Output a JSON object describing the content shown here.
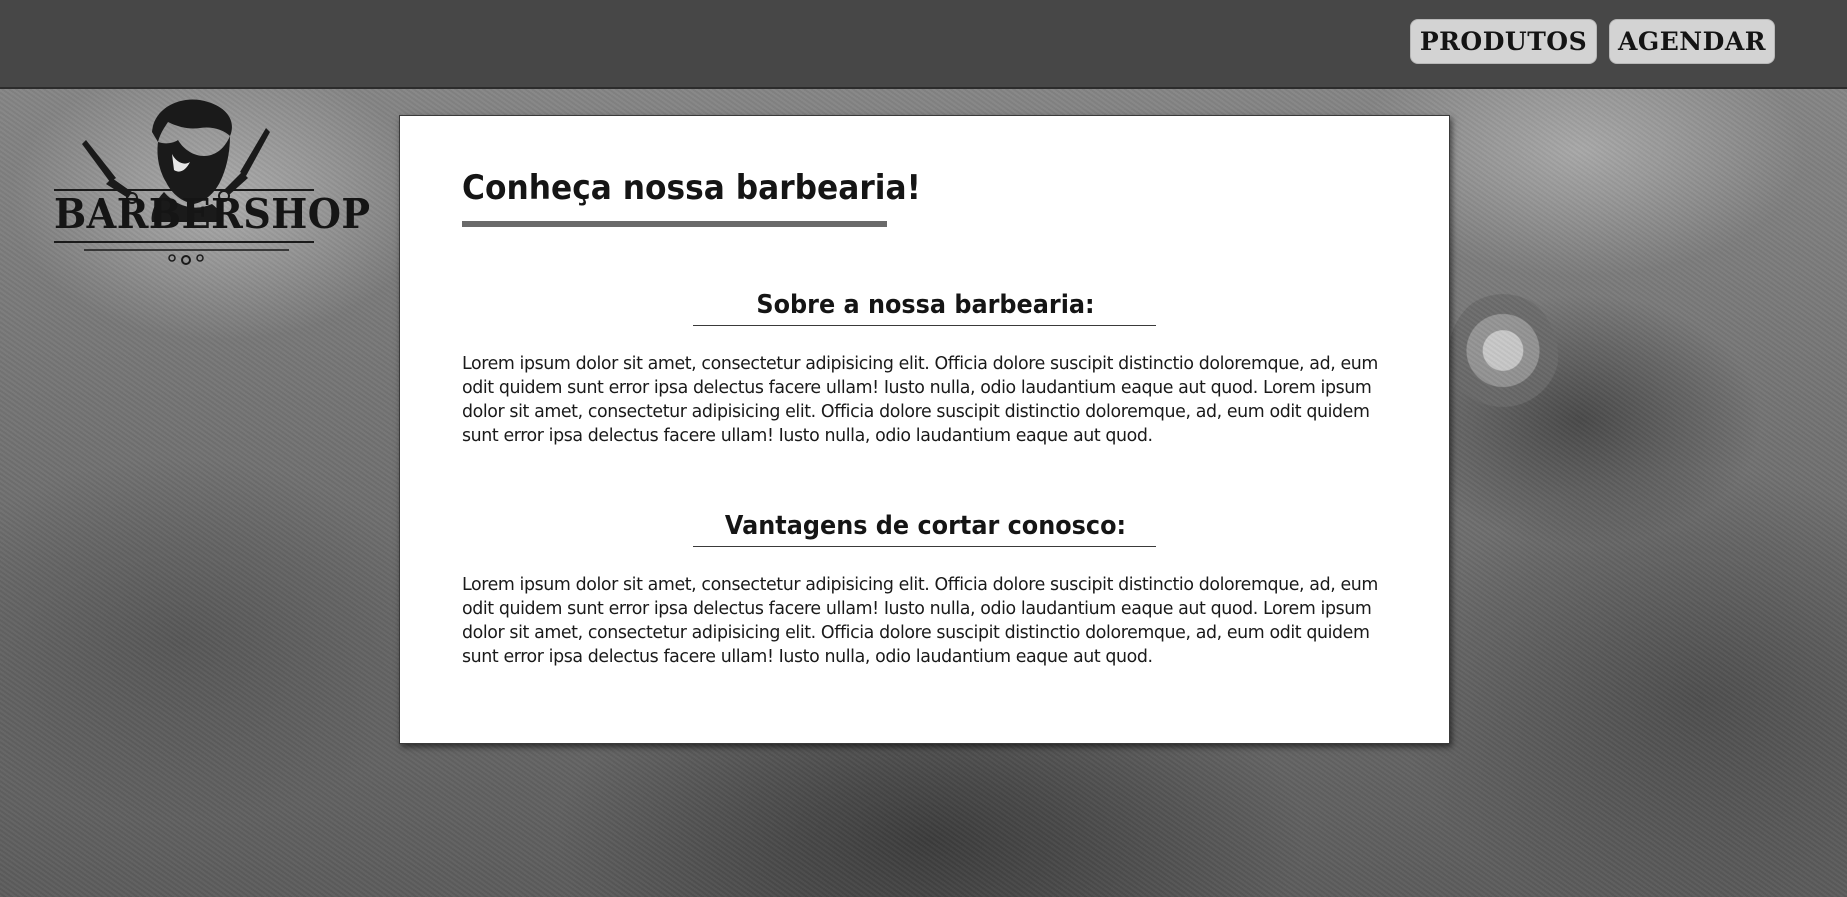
{
  "nav": {
    "produtos": "PRODUTOS",
    "agendar": "AGENDAR"
  },
  "logo": {
    "text": "BARBERSHOP"
  },
  "content": {
    "title": "Conheça nossa barbearia!",
    "sections": [
      {
        "heading": "Sobre a nossa barbearia:",
        "text": "Lorem ipsum dolor sit amet, consectetur adipisicing elit. Officia dolore suscipit distinctio doloremque, ad, eum odit quidem sunt error ipsa delectus facere ullam! Iusto nulla, odio laudantium eaque aut quod. Lorem ipsum dolor sit amet, consectetur adipisicing elit. Officia dolore suscipit distinctio doloremque, ad, eum odit quidem sunt error ipsa delectus facere ullam! Iusto nulla, odio laudantium eaque aut quod."
      },
      {
        "heading": "Vantagens de cortar conosco:",
        "text": "Lorem ipsum dolor sit amet, consectetur adipisicing elit. Officia dolore suscipit distinctio doloremque, ad, eum odit quidem sunt error ipsa delectus facere ullam! Iusto nulla, odio laudantium eaque aut quod. Lorem ipsum dolor sit amet, consectetur adipisicing elit. Officia dolore suscipit distinctio doloremque, ad, eum odit quidem sunt error ipsa delectus facere ullam! Iusto nulla, odio laudantium eaque aut quod."
      }
    ]
  },
  "colors": {
    "header_bg": "#474747",
    "nav_button_bg": "#d3d3d3",
    "card_bg": "#ffffff",
    "title_underline": "#6a6a6a"
  },
  "icons": {
    "logo": "barber-beard-icon",
    "razor": "straight-razor-icon"
  }
}
